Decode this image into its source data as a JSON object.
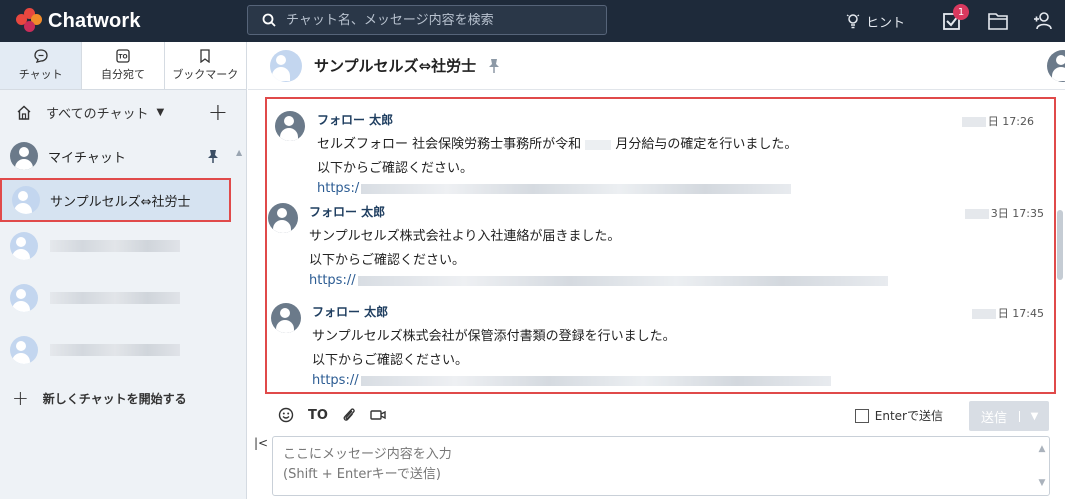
{
  "app": {
    "name": "Chatwork"
  },
  "search": {
    "placeholder": "チャット名、メッセージ内容を検索"
  },
  "topbar": {
    "hint_label": "ヒント",
    "task_badge": "1"
  },
  "sidebar": {
    "tabs": [
      {
        "label": "チャット"
      },
      {
        "label": "自分宛て"
      },
      {
        "label": "ブックマーク"
      }
    ],
    "filter_label": "すべてのチャット",
    "my_chat_label": "マイチャット",
    "selected_chat_label": "サンプルセルズ⇔社労士",
    "new_chat_label": "新しくチャットを開始する"
  },
  "room": {
    "title": "サンプルセルズ⇔社労士"
  },
  "messages": [
    {
      "sender": "フォロー 太郎",
      "time": "日 17:26",
      "line1_a": "セルズフォロー 社会保険労務士事務所が令和",
      "line1_b": "月分給与の確定を行いました。",
      "line2": "以下からご確認ください。",
      "url": "https:/"
    },
    {
      "sender": "フォロー 太郎",
      "time": "3日 17:35",
      "line1": "サンプルセルズ株式会社より入社連絡が届きました。",
      "line2": "以下からご確認ください。",
      "url": "https://"
    },
    {
      "sender": "フォロー 太郎",
      "time": "日 17:45",
      "line1": "サンプルセルズ株式会社が保管添付書類の登録を行いました。",
      "line2": "以下からご確認ください。",
      "url": "https://"
    }
  ],
  "composer": {
    "to_label": "TO",
    "enter_send_label": "Enterで送信",
    "send_label": "送信",
    "placeholder_line1": "ここにメッセージ内容を入力",
    "placeholder_line2": "(Shift + Enterキーで送信)"
  }
}
